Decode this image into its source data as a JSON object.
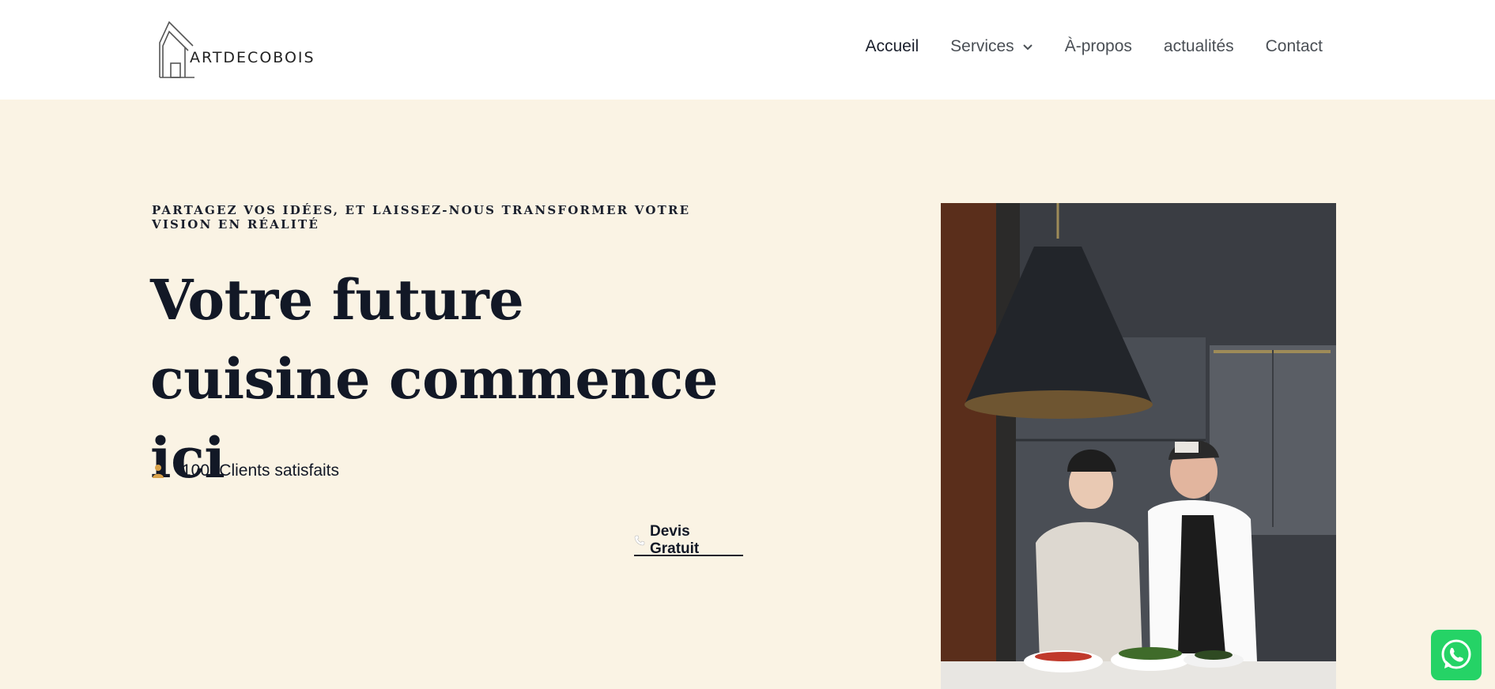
{
  "header": {
    "logo_text": "ARTDECOBOIS",
    "logo_icon": "house-outline-icon",
    "nav": [
      {
        "label": "Accueil",
        "active": true
      },
      {
        "label": "Services",
        "has_dropdown": true
      },
      {
        "label": "À-propos"
      },
      {
        "label": "actualités"
      },
      {
        "label": "Contact"
      }
    ]
  },
  "hero": {
    "kicker": "PARTAGEZ VOS IDÉES, ET LAISSEZ-NOUS TRANSFORMER VOTRE VISION EN RÉALITÉ",
    "headline": "Votre future cuisine commence ici",
    "stat": {
      "icon": "person-icon",
      "text": "100+Clients satisfaits",
      "icon_color": "#D9A24A"
    },
    "cta": {
      "label": "Devis Gratuit",
      "icon": "phone-icon"
    },
    "image_icon": "kitchen-photo"
  },
  "whatsapp": {
    "icon": "whatsapp-icon",
    "color": "#25D366"
  },
  "colors": {
    "background": "#FAF3E4",
    "header": "#FFFFFF",
    "text_dark": "#121826"
  }
}
